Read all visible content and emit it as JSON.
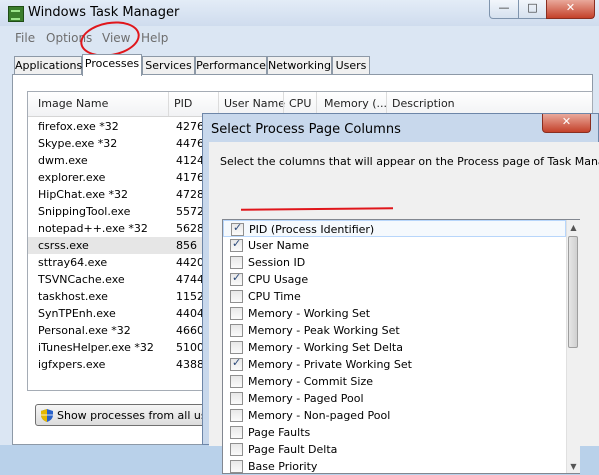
{
  "window": {
    "title": "Windows Task Manager",
    "min_label": "—",
    "max_label": "□",
    "close_label": "✕"
  },
  "menu": [
    "File",
    "Options",
    "View",
    "Help"
  ],
  "tabs": [
    "Applications",
    "Processes",
    "Services",
    "Performance",
    "Networking",
    "Users"
  ],
  "active_tab": "Processes",
  "columns": [
    "Image Name",
    "PID",
    "User Name",
    "CPU",
    "Memory (...",
    "Description"
  ],
  "processes": [
    {
      "name": "firefox.exe *32",
      "pid": "4276"
    },
    {
      "name": "Skype.exe *32",
      "pid": "4476"
    },
    {
      "name": "dwm.exe",
      "pid": "4124"
    },
    {
      "name": "explorer.exe",
      "pid": "4176"
    },
    {
      "name": "HipChat.exe *32",
      "pid": "4728"
    },
    {
      "name": "SnippingTool.exe",
      "pid": "5572"
    },
    {
      "name": "notepad++.exe *32",
      "pid": "5628"
    },
    {
      "name": "csrss.exe",
      "pid": "856"
    },
    {
      "name": "sttray64.exe",
      "pid": "4420"
    },
    {
      "name": "TSVNCache.exe",
      "pid": "4744"
    },
    {
      "name": "taskhost.exe",
      "pid": "1152"
    },
    {
      "name": "SynTPEnh.exe",
      "pid": "4404"
    },
    {
      "name": "Personal.exe *32",
      "pid": "4660"
    },
    {
      "name": "iTunesHelper.exe *32",
      "pid": "5100"
    },
    {
      "name": "igfxpers.exe",
      "pid": "4388"
    }
  ],
  "selected_process": "csrss.exe",
  "show_all_button": "Show processes from all users",
  "dialog": {
    "title": "Select Process Page Columns",
    "close_label": "✕",
    "instruction": "Select the columns that will appear on the Process page of Task Manager.",
    "items": [
      {
        "label": "PID (Process Identifier)",
        "checked": true
      },
      {
        "label": "User Name",
        "checked": true
      },
      {
        "label": "Session ID",
        "checked": false
      },
      {
        "label": "CPU Usage",
        "checked": true
      },
      {
        "label": "CPU Time",
        "checked": false
      },
      {
        "label": "Memory - Working Set",
        "checked": false
      },
      {
        "label": "Memory - Peak Working Set",
        "checked": false
      },
      {
        "label": "Memory - Working Set Delta",
        "checked": false
      },
      {
        "label": "Memory - Private Working Set",
        "checked": true
      },
      {
        "label": "Memory - Commit Size",
        "checked": false
      },
      {
        "label": "Memory - Paged Pool",
        "checked": false
      },
      {
        "label": "Memory - Non-paged Pool",
        "checked": false
      },
      {
        "label": "Page Faults",
        "checked": false
      },
      {
        "label": "Page Fault Delta",
        "checked": false
      },
      {
        "label": "Base Priority",
        "checked": false
      }
    ],
    "scroll_up": "▲",
    "scroll_down": "▼"
  },
  "annotation_color": "#e0161b"
}
